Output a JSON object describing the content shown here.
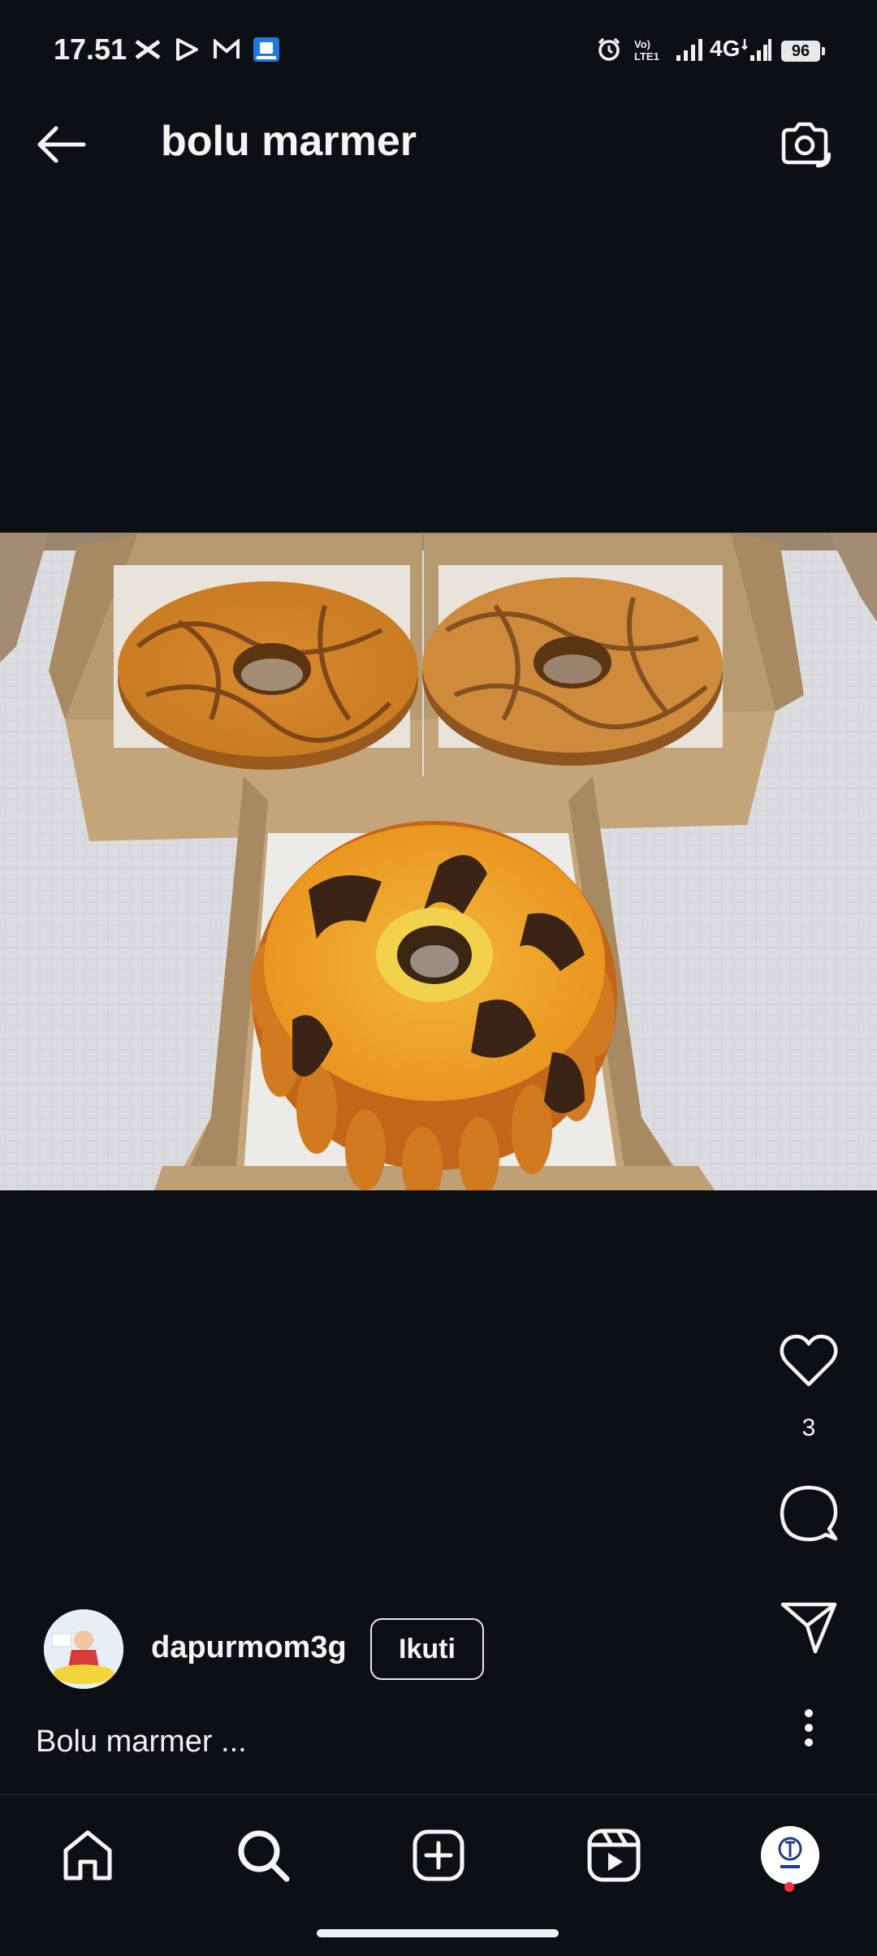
{
  "status_bar": {
    "time": "17.51",
    "network_label": "4G",
    "battery_level": "96"
  },
  "header": {
    "title": "bolu marmer"
  },
  "post": {
    "like_count": "3",
    "author_name": "dapurmom3g",
    "follow_label": "Ikuti",
    "caption": "Bolu marmer ..."
  },
  "icons": {
    "back": "back-arrow-icon",
    "camera": "camera-icon",
    "like": "heart-icon",
    "comment": "comment-icon",
    "share": "send-icon",
    "more": "more-vertical-icon",
    "nav": [
      "home-icon",
      "search-icon",
      "create-icon",
      "reels-icon",
      "profile-avatar"
    ]
  },
  "colors": {
    "background": "#0c1014",
    "text": "#f5f5f5",
    "notification": "#ff3040"
  }
}
